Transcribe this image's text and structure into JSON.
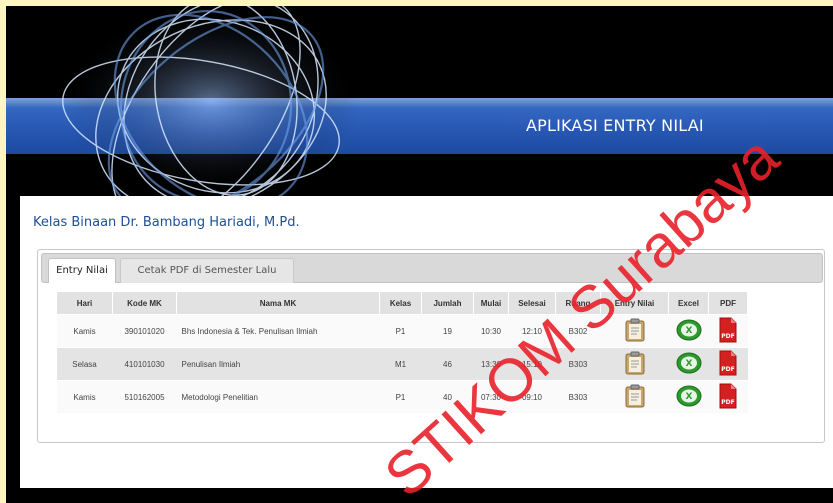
{
  "header": {
    "title": "APLIKASI ENTRY NILAI"
  },
  "page": {
    "heading": "Kelas Binaan Dr. Bambang Hariadi, M.Pd."
  },
  "tabs": [
    {
      "label": "Entry Nilai",
      "active": true
    },
    {
      "label": "Cetak PDF di Semester Lalu",
      "active": false
    }
  ],
  "table": {
    "columns": [
      "Hari",
      "Kode MK",
      "Nama MK",
      "Kelas",
      "Jumlah",
      "Mulai",
      "Selesai",
      "Ruang",
      "Entry Nilai",
      "Excel",
      "PDF"
    ],
    "rows": [
      {
        "hari": "Kamis",
        "kode": "390101020",
        "nama": "Bhs Indonesia & Tek. Penulisan Ilmiah",
        "kelas": "P1",
        "jumlah": "19",
        "mulai": "10:30",
        "selesai": "12:10",
        "ruang": "B302"
      },
      {
        "hari": "Selasa",
        "kode": "410101030",
        "nama": "Penulisan Ilmiah",
        "kelas": "M1",
        "jumlah": "46",
        "mulai": "13:30",
        "selesai": "15:10",
        "ruang": "B303"
      },
      {
        "hari": "Kamis",
        "kode": "510162005",
        "nama": "Metodologi Penelitian",
        "kelas": "P1",
        "jumlah": "40",
        "mulai": "07:30",
        "selesai": "09:10",
        "ruang": "B303"
      }
    ]
  },
  "watermark": {
    "text": "STIKOM Surabaya",
    "color": "#e8202a"
  },
  "icons": {
    "entry": "clipboard-icon",
    "excel": "excel-icon",
    "pdf": "pdf-icon"
  },
  "colors": {
    "banner_blue": "#2a5cb8",
    "heading": "#1f4f96",
    "pdf_red": "#d42020",
    "excel_green": "#2e9a2e"
  }
}
